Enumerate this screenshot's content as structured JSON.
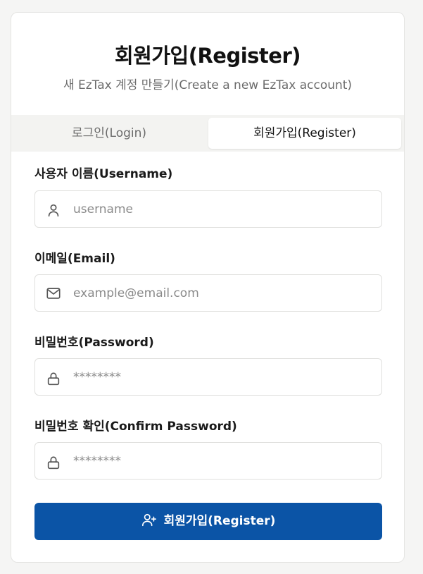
{
  "header": {
    "title": "회원가입(Register)",
    "subtitle": "새 EzTax 계정 만들기(Create a new EzTax account)"
  },
  "tabs": {
    "login_label": "로그인(Login)",
    "register_label": "회원가입(Register)",
    "active": "register"
  },
  "form": {
    "username": {
      "label": "사용자 이름(Username)",
      "placeholder": "username",
      "value": "",
      "icon": "user-icon"
    },
    "email": {
      "label": "이메일(Email)",
      "placeholder": "example@email.com",
      "value": "",
      "icon": "mail-icon"
    },
    "password": {
      "label": "비밀번호(Password)",
      "placeholder": "********",
      "value": "",
      "icon": "lock-icon"
    },
    "confirm_password": {
      "label": "비밀번호 확인(Confirm Password)",
      "placeholder": "********",
      "value": "",
      "icon": "lock-icon"
    },
    "submit_label": "회원가입(Register)",
    "submit_icon": "user-plus-icon"
  },
  "colors": {
    "primary": "#0b54a6",
    "tab_bg": "#f3f3f1",
    "border": "#e0e0de"
  }
}
